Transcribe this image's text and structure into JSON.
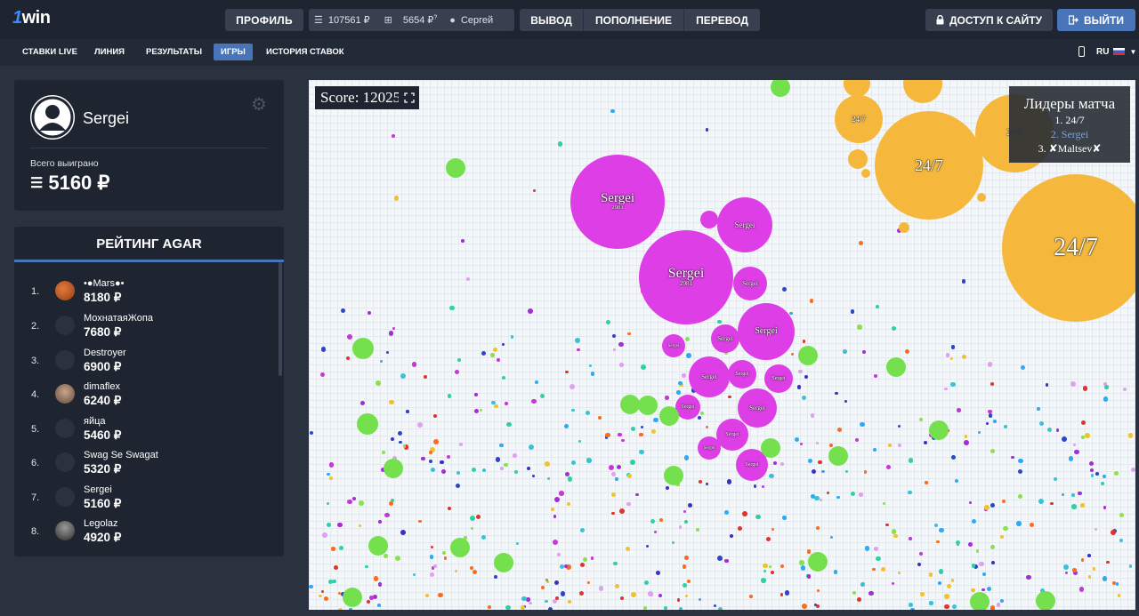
{
  "header": {
    "logo_num": "1",
    "logo_text": "win",
    "profile_label": "ПРОФИЛЬ",
    "balance": "107561 ₽",
    "bonus": "5654 ₽",
    "bonus_sup": "?",
    "username": "Сергей",
    "withdraw_label": "ВЫВОД",
    "deposit_label": "ПОПОЛНЕНИЕ",
    "transfer_label": "ПЕРЕВОД",
    "access_label": "ДОСТУП К САЙТУ",
    "logout_label": "ВЫЙТИ"
  },
  "nav": {
    "items": [
      "СТАВКИ LIVE",
      "ЛИНИЯ",
      "РЕЗУЛЬТАТЫ",
      "ИГРЫ",
      "ИСТОРИЯ СТАВОК"
    ],
    "active": "ИГРЫ",
    "language": "RU"
  },
  "profile": {
    "name": "Sergei",
    "won_label": "Всего выиграно",
    "won_value": "5160 ₽"
  },
  "rating": {
    "title": "РЕЙТИНГ AGAR",
    "rows": [
      {
        "rank": "1.",
        "name": "•●Mars●•",
        "score": "8180 ₽",
        "avatar": "mars-avatar"
      },
      {
        "rank": "2.",
        "name": "МохнатаяЖопа",
        "score": "7680 ₽",
        "avatar": "default-avatar"
      },
      {
        "rank": "3.",
        "name": "Destroyer",
        "score": "6900 ₽",
        "avatar": "default-avatar"
      },
      {
        "rank": "4.",
        "name": "dimaflex",
        "score": "6240 ₽",
        "avatar": "photo-avatar"
      },
      {
        "rank": "5.",
        "name": "яйца",
        "score": "5460 ₽",
        "avatar": "default-avatar"
      },
      {
        "rank": "6.",
        "name": "Swag Se Swagat",
        "score": "5320 ₽",
        "avatar": "default-avatar"
      },
      {
        "rank": "7.",
        "name": "Sergei",
        "score": "5160 ₽",
        "avatar": "default-avatar"
      },
      {
        "rank": "8.",
        "name": "Legolaz",
        "score": "4920 ₽",
        "avatar": "photo-avatar"
      }
    ]
  },
  "game": {
    "score_label": "Score: 12025",
    "leaders_title": "Лидеры матча",
    "leaders": [
      "1. 24/7",
      "2. Sergei",
      "3. ✘Maltsev✘"
    ],
    "player_name": "Sergei",
    "player_mass": "2981",
    "enemy_name": "24/7",
    "colors": {
      "player": "#dd3ee6",
      "enemy": "#f5b83d",
      "food_green": "#74e04d"
    }
  }
}
